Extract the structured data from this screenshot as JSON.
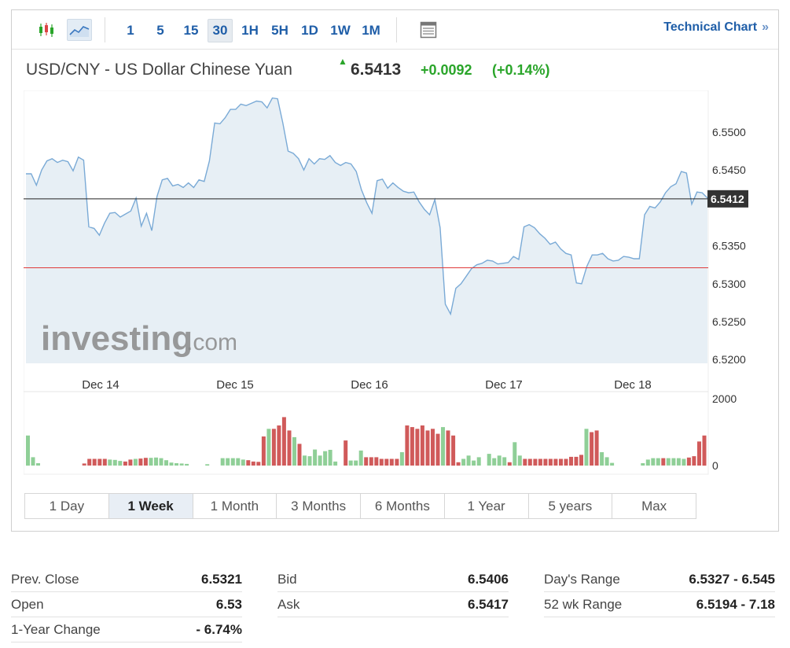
{
  "toolbar": {
    "chart_types": [
      {
        "name": "candlestick-icon",
        "active": false
      },
      {
        "name": "line-chart-icon",
        "active": true
      }
    ],
    "intervals": [
      {
        "label": "1",
        "active": false
      },
      {
        "label": "5",
        "active": false
      },
      {
        "label": "15",
        "active": false
      },
      {
        "label": "30",
        "active": true
      },
      {
        "label": "1H",
        "active": false
      },
      {
        "label": "5H",
        "active": false
      },
      {
        "label": "1D",
        "active": false
      },
      {
        "label": "1W",
        "active": false
      },
      {
        "label": "1M",
        "active": false
      }
    ],
    "layout_icon": "layout-icon",
    "technical_chart_label": "Technical Chart",
    "technical_chart_chevron": "»"
  },
  "quote": {
    "pair": "USD/CNY - US Dollar Chinese Yuan",
    "arrow": "▲",
    "price": "6.5413",
    "change": "+0.0092",
    "change_pct": "(+0.14%)"
  },
  "colors": {
    "accent": "#1f5ea8",
    "up": "#2aa52a",
    "line": "#7aaad6",
    "area": "#e3ecf3",
    "prev_close_line": "#e03a3a",
    "vol_up": "#8fcf97",
    "vol_down": "#d05a5a"
  },
  "chart_data": {
    "type": "area",
    "watermark": "Investing.com",
    "y_ticks": [
      "6.5500",
      "6.5450",
      "6.5350",
      "6.5300",
      "6.5250",
      "6.5200"
    ],
    "ylim": [
      6.5195,
      6.5555
    ],
    "x_labels": [
      "Dec 14",
      "Dec 15",
      "Dec 16",
      "Dec 17",
      "Dec 18"
    ],
    "current_price_label": "6.5412",
    "current_price": 6.5412,
    "prev_close_level": 6.5321,
    "series": [
      {
        "values": [
          6.5445,
          6.5445,
          6.543,
          6.545,
          6.5462,
          6.5465,
          6.546,
          6.5463,
          6.5461,
          6.5449,
          6.5467,
          6.5463,
          6.5375,
          6.5373,
          6.5364,
          6.538,
          6.5393,
          6.5394,
          6.5388,
          6.5392,
          6.5396,
          6.5413,
          6.5376,
          6.5393,
          6.537,
          6.5415,
          6.5437,
          6.5439,
          6.5429,
          6.5431,
          6.5427,
          6.5433,
          6.5427,
          6.5437,
          6.5435,
          6.5462,
          6.5512,
          6.5511,
          6.5519,
          6.553,
          6.553,
          6.5537,
          6.5535,
          6.5538,
          6.5541,
          6.554,
          6.5532,
          6.5545,
          6.5544,
          6.5512,
          6.5475,
          6.5472,
          6.5465,
          6.545,
          6.5465,
          6.5458,
          6.5465,
          6.5464,
          6.5469,
          6.546,
          6.5456,
          6.546,
          6.5458,
          6.5448,
          6.5424,
          6.5407,
          6.5393,
          6.5436,
          6.5438,
          6.5426,
          6.5433,
          6.5427,
          6.5422,
          6.542,
          6.5421,
          6.5408,
          6.5398,
          6.5391,
          6.5411,
          6.5374,
          6.5273,
          6.526,
          6.5294,
          6.53,
          6.531,
          6.532,
          6.5325,
          6.5327,
          6.5331,
          6.533,
          6.5326,
          6.5327,
          6.5328,
          6.5336,
          6.5332,
          6.5375,
          6.5378,
          6.5374,
          6.5366,
          6.536,
          6.5352,
          6.5355,
          6.5346,
          6.534,
          6.5338,
          6.5301,
          6.53,
          6.5323,
          6.5338,
          6.5338,
          6.534,
          6.5333,
          6.533,
          6.5331,
          6.5336,
          6.5335,
          6.5333,
          6.5333,
          6.5391,
          6.5402,
          6.54,
          6.5408,
          6.542,
          6.5428,
          6.5432,
          6.5448,
          6.5446,
          6.5405,
          6.5421,
          6.542,
          6.5413
        ]
      }
    ],
    "volume": {
      "y_ticks": [
        "2000",
        "0"
      ],
      "bars": [
        {
          "v": 900,
          "d": "u"
        },
        {
          "v": 250,
          "d": "u"
        },
        {
          "v": 70,
          "d": "u"
        },
        {
          "v": 0,
          "d": "u"
        },
        {
          "v": 0,
          "d": "u"
        },
        {
          "v": 0,
          "d": "u"
        },
        {
          "v": 0,
          "d": "u"
        },
        {
          "v": 0,
          "d": "u"
        },
        {
          "v": 0,
          "d": "u"
        },
        {
          "v": 0,
          "d": "u"
        },
        {
          "v": 0,
          "d": "u"
        },
        {
          "v": 60,
          "d": "d"
        },
        {
          "v": 200,
          "d": "d"
        },
        {
          "v": 200,
          "d": "d"
        },
        {
          "v": 200,
          "d": "d"
        },
        {
          "v": 200,
          "d": "d"
        },
        {
          "v": 180,
          "d": "u"
        },
        {
          "v": 170,
          "d": "u"
        },
        {
          "v": 140,
          "d": "u"
        },
        {
          "v": 120,
          "d": "d"
        },
        {
          "v": 180,
          "d": "d"
        },
        {
          "v": 200,
          "d": "u"
        },
        {
          "v": 210,
          "d": "d"
        },
        {
          "v": 230,
          "d": "d"
        },
        {
          "v": 230,
          "d": "u"
        },
        {
          "v": 240,
          "d": "u"
        },
        {
          "v": 220,
          "d": "u"
        },
        {
          "v": 160,
          "d": "u"
        },
        {
          "v": 90,
          "d": "u"
        },
        {
          "v": 70,
          "d": "u"
        },
        {
          "v": 60,
          "d": "u"
        },
        {
          "v": 50,
          "d": "u"
        },
        {
          "v": 0,
          "d": "u"
        },
        {
          "v": 0,
          "d": "u"
        },
        {
          "v": 0,
          "d": "u"
        },
        {
          "v": 40,
          "d": "u"
        },
        {
          "v": 0,
          "d": "u"
        },
        {
          "v": 0,
          "d": "u"
        },
        {
          "v": 220,
          "d": "u"
        },
        {
          "v": 220,
          "d": "u"
        },
        {
          "v": 220,
          "d": "u"
        },
        {
          "v": 220,
          "d": "u"
        },
        {
          "v": 180,
          "d": "u"
        },
        {
          "v": 160,
          "d": "d"
        },
        {
          "v": 120,
          "d": "d"
        },
        {
          "v": 110,
          "d": "d"
        },
        {
          "v": 870,
          "d": "d"
        },
        {
          "v": 1100,
          "d": "u"
        },
        {
          "v": 1100,
          "d": "d"
        },
        {
          "v": 1200,
          "d": "d"
        },
        {
          "v": 1450,
          "d": "d"
        },
        {
          "v": 1050,
          "d": "d"
        },
        {
          "v": 850,
          "d": "u"
        },
        {
          "v": 650,
          "d": "d"
        },
        {
          "v": 300,
          "d": "u"
        },
        {
          "v": 280,
          "d": "u"
        },
        {
          "v": 480,
          "d": "u"
        },
        {
          "v": 300,
          "d": "u"
        },
        {
          "v": 430,
          "d": "u"
        },
        {
          "v": 470,
          "d": "u"
        },
        {
          "v": 120,
          "d": "u"
        },
        {
          "v": 0,
          "d": "u"
        },
        {
          "v": 750,
          "d": "d"
        },
        {
          "v": 150,
          "d": "u"
        },
        {
          "v": 150,
          "d": "u"
        },
        {
          "v": 450,
          "d": "u"
        },
        {
          "v": 250,
          "d": "d"
        },
        {
          "v": 250,
          "d": "d"
        },
        {
          "v": 250,
          "d": "d"
        },
        {
          "v": 200,
          "d": "d"
        },
        {
          "v": 200,
          "d": "d"
        },
        {
          "v": 200,
          "d": "d"
        },
        {
          "v": 200,
          "d": "d"
        },
        {
          "v": 400,
          "d": "u"
        },
        {
          "v": 1200,
          "d": "d"
        },
        {
          "v": 1150,
          "d": "d"
        },
        {
          "v": 1100,
          "d": "d"
        },
        {
          "v": 1200,
          "d": "d"
        },
        {
          "v": 1050,
          "d": "d"
        },
        {
          "v": 1100,
          "d": "d"
        },
        {
          "v": 950,
          "d": "d"
        },
        {
          "v": 1150,
          "d": "u"
        },
        {
          "v": 1050,
          "d": "d"
        },
        {
          "v": 900,
          "d": "d"
        },
        {
          "v": 100,
          "d": "d"
        },
        {
          "v": 200,
          "d": "u"
        },
        {
          "v": 300,
          "d": "u"
        },
        {
          "v": 150,
          "d": "u"
        },
        {
          "v": 250,
          "d": "u"
        },
        {
          "v": 0,
          "d": "u"
        },
        {
          "v": 350,
          "d": "u"
        },
        {
          "v": 220,
          "d": "u"
        },
        {
          "v": 300,
          "d": "u"
        },
        {
          "v": 250,
          "d": "u"
        },
        {
          "v": 100,
          "d": "d"
        },
        {
          "v": 700,
          "d": "u"
        },
        {
          "v": 300,
          "d": "u"
        },
        {
          "v": 200,
          "d": "d"
        },
        {
          "v": 200,
          "d": "d"
        },
        {
          "v": 200,
          "d": "d"
        },
        {
          "v": 200,
          "d": "d"
        },
        {
          "v": 200,
          "d": "d"
        },
        {
          "v": 200,
          "d": "d"
        },
        {
          "v": 200,
          "d": "d"
        },
        {
          "v": 200,
          "d": "d"
        },
        {
          "v": 200,
          "d": "d"
        },
        {
          "v": 260,
          "d": "d"
        },
        {
          "v": 260,
          "d": "d"
        },
        {
          "v": 320,
          "d": "d"
        },
        {
          "v": 1100,
          "d": "u"
        },
        {
          "v": 1000,
          "d": "d"
        },
        {
          "v": 1050,
          "d": "d"
        },
        {
          "v": 400,
          "d": "u"
        },
        {
          "v": 250,
          "d": "u"
        },
        {
          "v": 80,
          "d": "u"
        },
        {
          "v": 0,
          "d": "u"
        },
        {
          "v": 0,
          "d": "u"
        },
        {
          "v": 0,
          "d": "u"
        },
        {
          "v": 0,
          "d": "u"
        },
        {
          "v": 0,
          "d": "u"
        },
        {
          "v": 70,
          "d": "u"
        },
        {
          "v": 180,
          "d": "u"
        },
        {
          "v": 220,
          "d": "u"
        },
        {
          "v": 220,
          "d": "u"
        },
        {
          "v": 220,
          "d": "d"
        },
        {
          "v": 220,
          "d": "u"
        },
        {
          "v": 220,
          "d": "u"
        },
        {
          "v": 220,
          "d": "u"
        },
        {
          "v": 200,
          "d": "u"
        },
        {
          "v": 240,
          "d": "d"
        },
        {
          "v": 280,
          "d": "d"
        },
        {
          "v": 720,
          "d": "d"
        },
        {
          "v": 900,
          "d": "d"
        }
      ]
    }
  },
  "ranges": [
    {
      "label": "1 Day",
      "active": false
    },
    {
      "label": "1 Week",
      "active": true
    },
    {
      "label": "1 Month",
      "active": false
    },
    {
      "label": "3 Months",
      "active": false
    },
    {
      "label": "6 Months",
      "active": false
    },
    {
      "label": "1 Year",
      "active": false
    },
    {
      "label": "5 years",
      "active": false
    },
    {
      "label": "Max",
      "active": false
    }
  ],
  "stats": {
    "col1": [
      {
        "label": "Prev. Close",
        "value": "6.5321"
      },
      {
        "label": "Open",
        "value": "6.53"
      },
      {
        "label": "1-Year Change",
        "value": "- 6.74%"
      }
    ],
    "col2": [
      {
        "label": "Bid",
        "value": "6.5406"
      },
      {
        "label": "Ask",
        "value": "6.5417"
      }
    ],
    "col3": [
      {
        "label": "Day's Range",
        "value": "6.5327 - 6.545"
      },
      {
        "label": "52 wk Range",
        "value": "6.5194 - 7.18"
      }
    ]
  }
}
